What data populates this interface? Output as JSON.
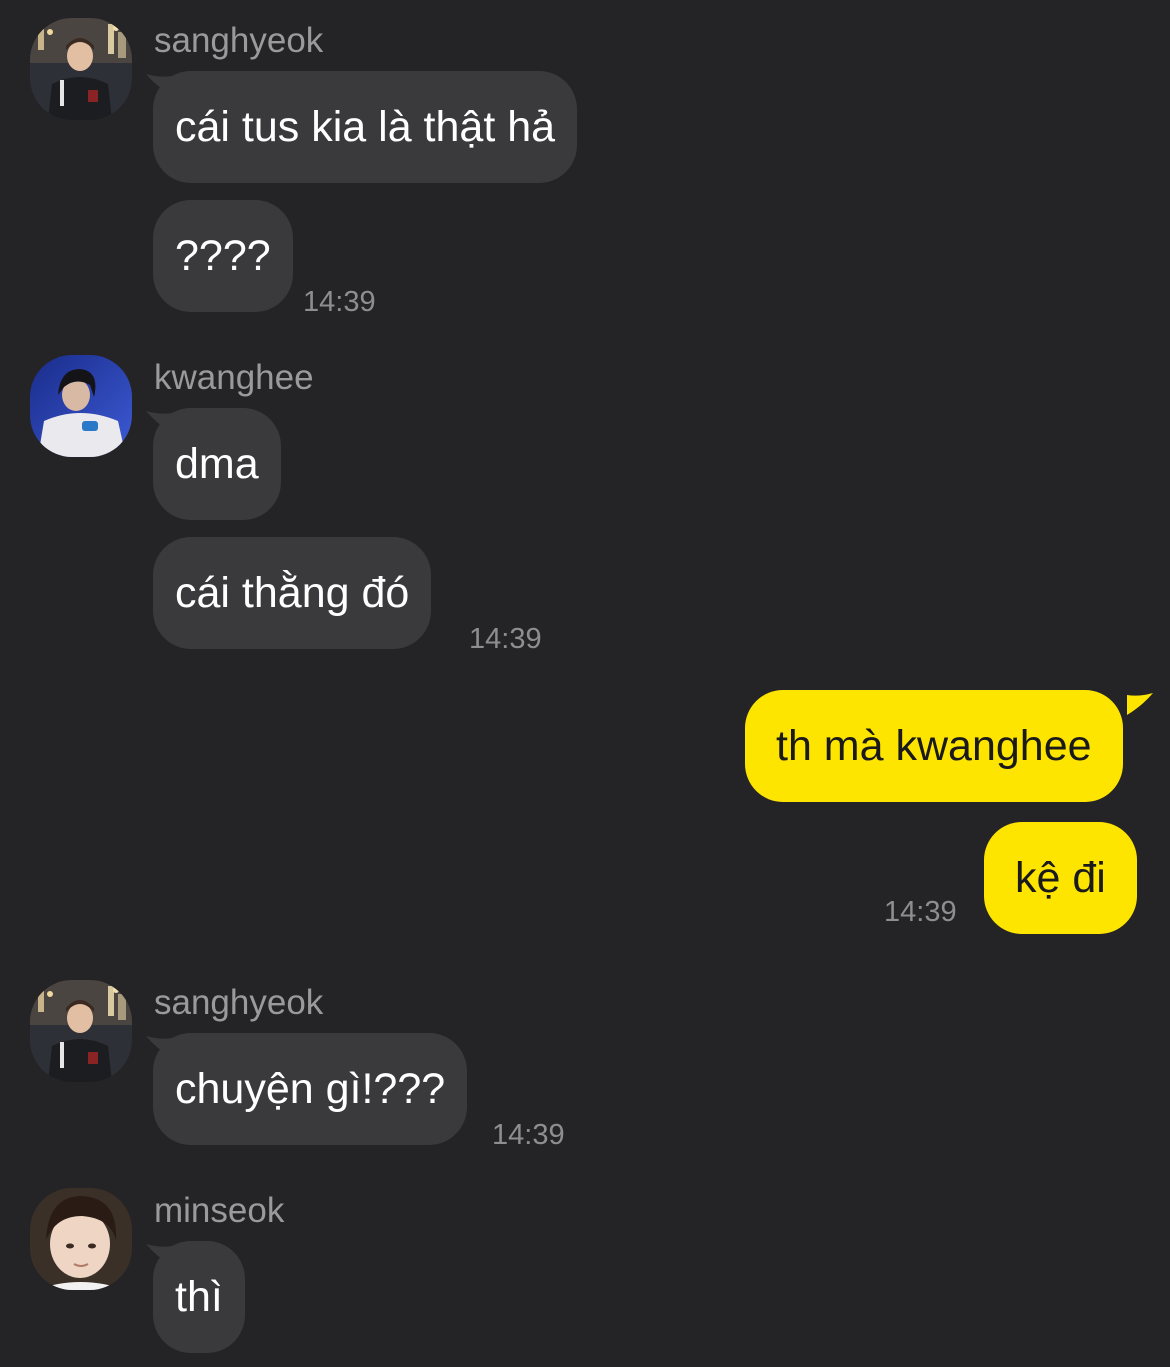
{
  "colors": {
    "background": "#242426",
    "incoming_bubble": "#3a3a3c",
    "outgoing_bubble": "#fee500",
    "meta_text": "#9a9a9e"
  },
  "messages": {
    "g1": {
      "sender": "sanghyeok",
      "avatar_icon": "sanghyeok-avatar-icon",
      "texts": [
        "cái tus kia là thật hả",
        "????"
      ],
      "time": "14:39"
    },
    "g2": {
      "sender": "kwanghee",
      "avatar_icon": "kwanghee-avatar-icon",
      "texts": [
        "dma",
        "cái thằng đó"
      ],
      "time": "14:39"
    },
    "g3": {
      "sender": "me",
      "texts": [
        "th mà kwanghee",
        "kệ đi"
      ],
      "time": "14:39"
    },
    "g4": {
      "sender": "sanghyeok",
      "avatar_icon": "sanghyeok-avatar-icon",
      "texts": [
        "chuyện gì!???"
      ],
      "time": "14:39"
    },
    "g5": {
      "sender": "minseok",
      "avatar_icon": "minseok-avatar-icon",
      "texts": [
        "thì"
      ]
    }
  }
}
